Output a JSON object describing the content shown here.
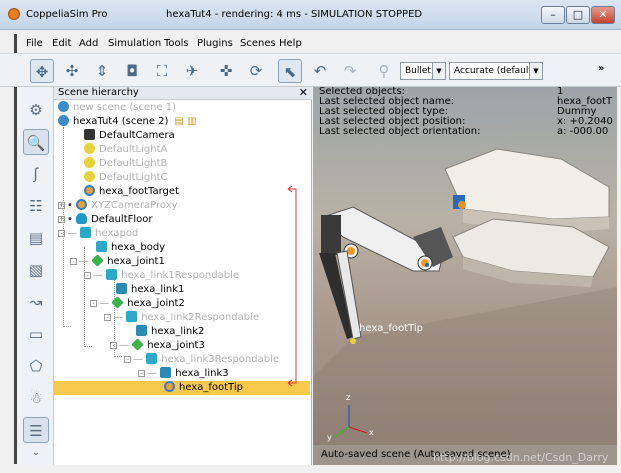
{
  "window": {
    "app_name": "CoppeliaSim Pro",
    "doc_title": "hexaTut4 - rendering: 4 ms - SIMULATION STOPPED",
    "min_glyph": "–",
    "max_glyph": "□",
    "close_glyph": "✕"
  },
  "menu": [
    "File",
    "Edit",
    "Add",
    "Simulation",
    "Tools",
    "Plugins",
    "Scenes",
    "Help"
  ],
  "toolbar": {
    "engine": "Bullet",
    "accuracy": "Accurate (default)",
    "more": "»"
  },
  "scene_hierarchy": {
    "header": "Scene hierarchy",
    "close": "✕",
    "items": [
      {
        "label": "new scene (scene 1)",
        "icon": "scene-icon",
        "gray": true
      },
      {
        "label": "hexaTut4 (scene 2)",
        "icon": "scene-icon",
        "gray": false
      },
      {
        "label": "DefaultCamera",
        "icon": "camera-icon",
        "gray": false
      },
      {
        "label": "DefaultLightA",
        "icon": "light-icon",
        "gray": true
      },
      {
        "label": "DefaultLightB",
        "icon": "light-icon",
        "gray": true
      },
      {
        "label": "DefaultLightC",
        "icon": "light-icon",
        "gray": true
      },
      {
        "label": "hexa_footTarget",
        "icon": "dummy-icon",
        "gray": false
      },
      {
        "label": "XYZCameraProxy",
        "icon": "dummy-icon",
        "gray": true
      },
      {
        "label": "DefaultFloor",
        "icon": "floor-icon",
        "gray": false
      },
      {
        "label": "hexapod",
        "icon": "shape-icon",
        "gray": true
      },
      {
        "label": "hexa_body",
        "icon": "shape-icon",
        "gray": false
      },
      {
        "label": "hexa_joint1",
        "icon": "joint-icon",
        "gray": false
      },
      {
        "label": "hexa_link1Respondable",
        "icon": "shape-icon",
        "gray": true
      },
      {
        "label": "hexa_link1",
        "icon": "link-icon",
        "gray": false
      },
      {
        "label": "hexa_joint2",
        "icon": "joint-icon",
        "gray": false
      },
      {
        "label": "hexa_link2Respondable",
        "icon": "shape-icon",
        "gray": true
      },
      {
        "label": "hexa_link2",
        "icon": "link-icon",
        "gray": false
      },
      {
        "label": "hexa_joint3",
        "icon": "joint-icon",
        "gray": false
      },
      {
        "label": "hexa_link3Respondable",
        "icon": "shape-icon",
        "gray": true
      },
      {
        "label": "hexa_link3",
        "icon": "link-icon",
        "gray": false
      },
      {
        "label": "hexa_footTip",
        "icon": "dummy-icon",
        "gray": false,
        "selected": true
      }
    ]
  },
  "viewport": {
    "info_labels": [
      "Selected objects:",
      "Last selected object name:",
      "Last selected object type:",
      "Last selected object position:",
      "Last selected object orientation:"
    ],
    "info_values": [
      "1",
      "hexa_footT",
      "Dummy",
      "x: +0.2040",
      "a: -000.00"
    ],
    "object_label": "hexa_footTip",
    "status": "Auto-saved scene (Auto-saved scene)",
    "watermark": "http://blog.csdn.net/Csdn_Darry",
    "axis_x": "x",
    "axis_y": "y",
    "axis_z": "z"
  },
  "colors": {
    "selection": "#f6c84b",
    "link_line": "#e03030"
  }
}
